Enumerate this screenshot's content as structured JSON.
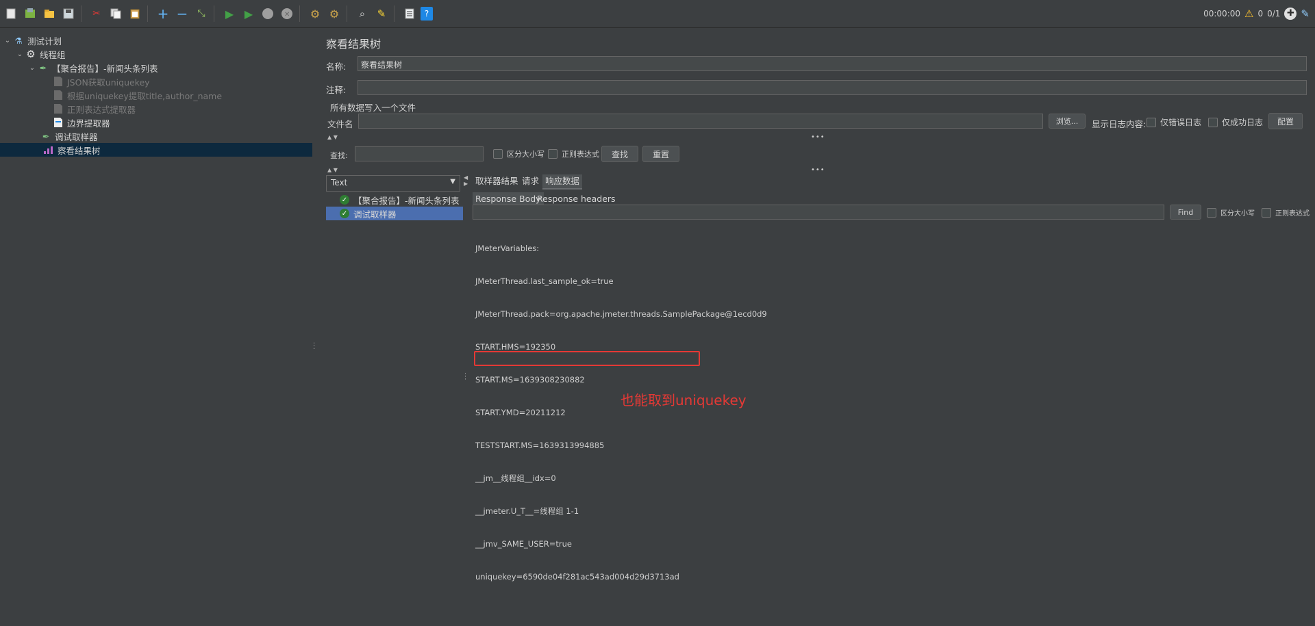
{
  "toolbar": {
    "icons": [
      "new-icon",
      "templates-icon",
      "open-icon",
      "save-icon",
      "cut-icon",
      "copy-icon",
      "paste-icon",
      "expand-icon",
      "collapse-icon",
      "toggle-icon",
      "start-icon",
      "start-no-pauses-icon",
      "stop-icon",
      "shutdown-icon",
      "clear-icon",
      "clear-all-icon",
      "search-icon",
      "reset-search-icon",
      "function-helper-icon",
      "help-icon"
    ],
    "timer": "00:00:00",
    "warnings": "0",
    "threads": "0/1"
  },
  "tree": {
    "items": [
      {
        "label": "测试计划",
        "icon": "test-plan-icon",
        "indent": 0,
        "chevron": "v"
      },
      {
        "label": "线程组",
        "icon": "thread-group-icon",
        "indent": 1,
        "chevron": "v"
      },
      {
        "label": "【聚合报告】-新闻头条列表",
        "icon": "sampler-icon",
        "indent": 2,
        "chevron": "v"
      },
      {
        "label": "JSON获取uniquekey",
        "icon": "extractor-icon",
        "indent": 3,
        "chevron": "",
        "disabled": true
      },
      {
        "label": "根据uniquekey提取title,author_name",
        "icon": "extractor-icon",
        "indent": 3,
        "chevron": "",
        "disabled": true
      },
      {
        "label": "正则表达式提取器",
        "icon": "extractor-icon",
        "indent": 3,
        "chevron": "",
        "disabled": true
      },
      {
        "label": "边界提取器",
        "icon": "extractor-icon",
        "indent": 3,
        "chevron": ""
      },
      {
        "label": "调试取样器",
        "icon": "debug-sampler-icon",
        "indent": 2,
        "chevron": ""
      },
      {
        "label": "察看结果树",
        "icon": "listener-icon",
        "indent": 2,
        "chevron": "",
        "selected": true
      }
    ]
  },
  "main": {
    "title": "察看结果树",
    "name_label": "名称:",
    "name_value": "察看结果树",
    "comment_label": "注释:",
    "comment_value": "",
    "file_section": "所有数据写入一个文件",
    "filename_label": "文件名",
    "filename_value": "",
    "browse_label": "浏览...",
    "log_label": "显示日志内容:",
    "errors_only": "仅错误日志",
    "success_only": "仅成功日志",
    "config_label": "配置",
    "search_label": "查找:",
    "search_value": "",
    "case_sensitive": "区分大小写",
    "regex": "正则表达式",
    "find_label": "查找",
    "reset_label": "重置"
  },
  "results": {
    "renderer": "Text",
    "rows": [
      {
        "label": "【聚合报告】-新闻头条列表"
      },
      {
        "label": "调试取样器",
        "selected": true
      }
    ]
  },
  "detail": {
    "tabs": [
      "取样器结果",
      "请求",
      "响应数据"
    ],
    "active_tab": "响应数据",
    "subtabs": [
      "Response Body",
      "Response headers"
    ],
    "active_subtab": "Response Body",
    "find_value": "",
    "find_label": "Find",
    "case_sensitive": "区分大小写",
    "regex": "正则表达式",
    "response_lines": [
      "JMeterVariables:",
      "JMeterThread.last_sample_ok=true",
      "JMeterThread.pack=org.apache.jmeter.threads.SamplePackage@1ecd0d9",
      "START.HMS=192350",
      "START.MS=1639308230882",
      "START.YMD=20211212",
      "TESTSTART.MS=1639313994885",
      "__jm__线程组__idx=0",
      "__jmeter.U_T__=线程组 1-1",
      "__jmv_SAME_USER=true",
      "uniquekey=6590de04f281ac543ad004d29d3713ad"
    ]
  },
  "annotation": "也能取到uniquekey"
}
